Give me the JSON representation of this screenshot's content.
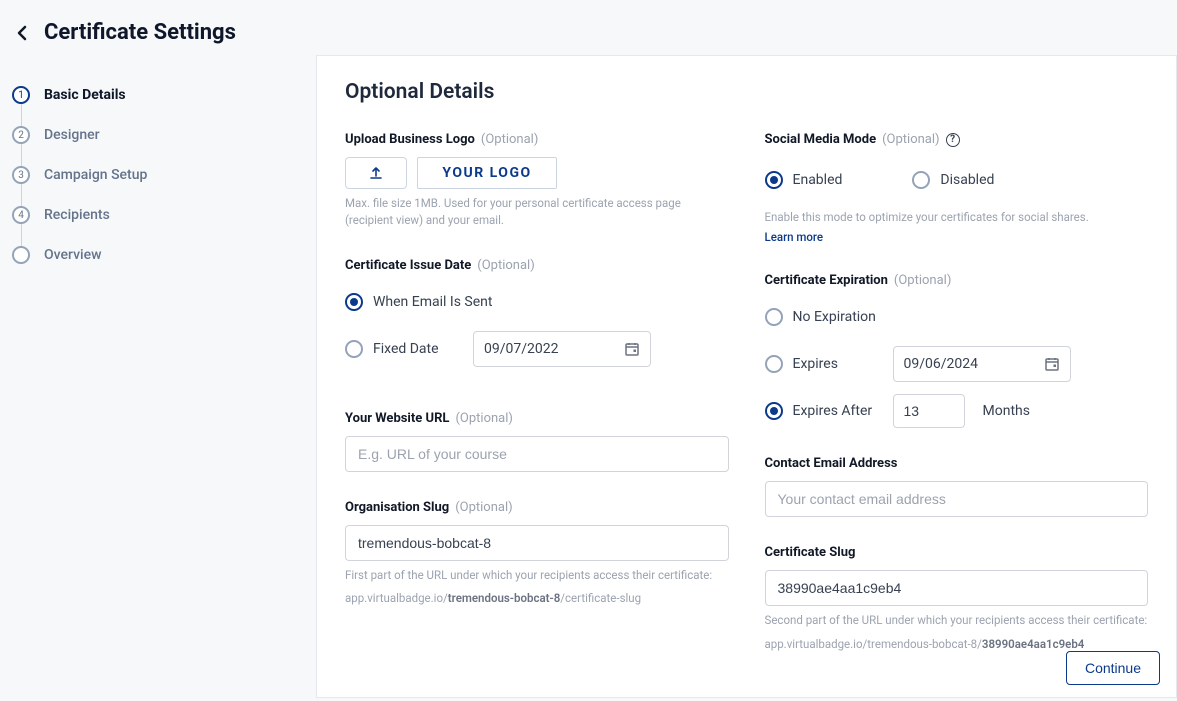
{
  "header": {
    "title": "Certificate Settings"
  },
  "steps": [
    {
      "number": "1",
      "label": "Basic Details",
      "active": true
    },
    {
      "number": "2",
      "label": "Designer",
      "active": false
    },
    {
      "number": "3",
      "label": "Campaign Setup",
      "active": false
    },
    {
      "number": "4",
      "label": "Recipients",
      "active": false
    },
    {
      "number": "",
      "label": "Overview",
      "active": false,
      "empty": true
    }
  ],
  "panel": {
    "title": "Optional Details"
  },
  "upload_logo": {
    "label": "Upload Business Logo",
    "optional": "(Optional)",
    "preview_text": "YOUR LOGO",
    "help": "Max. file size 1MB. Used for your personal certificate access page (recipient view) and your email."
  },
  "issue_date": {
    "label": "Certificate Issue Date",
    "optional": "(Optional)",
    "when_email": "When Email Is Sent",
    "fixed": "Fixed Date",
    "date_value": "09/07/2022"
  },
  "website": {
    "label": "Your Website URL",
    "optional": "(Optional)",
    "placeholder": "E.g. URL of your course",
    "value": ""
  },
  "org_slug": {
    "label": "Organisation Slug",
    "optional": "(Optional)",
    "value": "tremendous-bobcat-8",
    "help1": "First part of the URL under which your recipients access their certificate:",
    "url_prefix": "app.virtualbadge.io/",
    "url_bold": "tremendous-bobcat-8",
    "url_suffix": "/certificate-slug"
  },
  "social_mode": {
    "label": "Social Media Mode",
    "optional": "(Optional)",
    "enabled": "Enabled",
    "disabled": "Disabled",
    "help": "Enable this mode to optimize your certificates for social shares.",
    "learn_more": "Learn more"
  },
  "expiration": {
    "label": "Certificate Expiration",
    "optional": "(Optional)",
    "no_expiration": "No Expiration",
    "expires": "Expires",
    "expires_date": "09/06/2024",
    "expires_after": "Expires After",
    "expires_after_value": "13",
    "unit": "Months"
  },
  "contact_email": {
    "label": "Contact Email Address",
    "placeholder": "Your contact email address",
    "value": ""
  },
  "cert_slug": {
    "label": "Certificate Slug",
    "value": "38990ae4aa1c9eb4",
    "help1": "Second part of the URL under which your recipients access their certificate:",
    "url_prefix": "app.virtualbadge.io/tremendous-bobcat-8/",
    "url_bold": "38990ae4aa1c9eb4"
  },
  "continue": "Continue"
}
